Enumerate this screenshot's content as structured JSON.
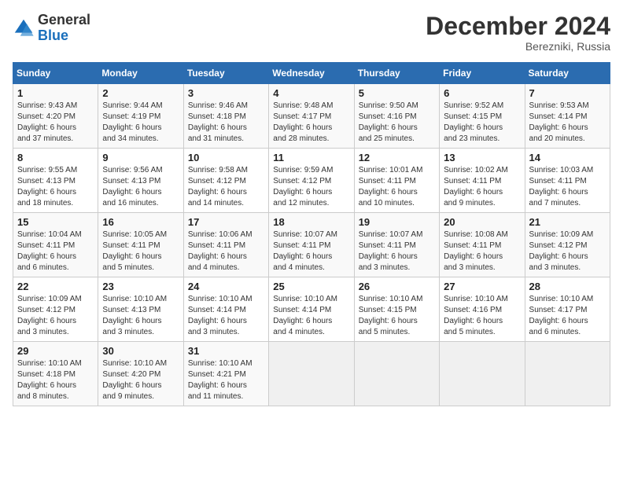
{
  "header": {
    "logo": {
      "general": "General",
      "blue": "Blue"
    },
    "title": "December 2024",
    "location": "Berezniki, Russia"
  },
  "weekdays": [
    "Sunday",
    "Monday",
    "Tuesday",
    "Wednesday",
    "Thursday",
    "Friday",
    "Saturday"
  ],
  "weeks": [
    [
      {
        "day": "1",
        "sunrise": "9:43 AM",
        "sunset": "4:20 PM",
        "daylight": "6 hours and 37 minutes."
      },
      {
        "day": "2",
        "sunrise": "9:44 AM",
        "sunset": "4:19 PM",
        "daylight": "6 hours and 34 minutes."
      },
      {
        "day": "3",
        "sunrise": "9:46 AM",
        "sunset": "4:18 PM",
        "daylight": "6 hours and 31 minutes."
      },
      {
        "day": "4",
        "sunrise": "9:48 AM",
        "sunset": "4:17 PM",
        "daylight": "6 hours and 28 minutes."
      },
      {
        "day": "5",
        "sunrise": "9:50 AM",
        "sunset": "4:16 PM",
        "daylight": "6 hours and 25 minutes."
      },
      {
        "day": "6",
        "sunrise": "9:52 AM",
        "sunset": "4:15 PM",
        "daylight": "6 hours and 23 minutes."
      },
      {
        "day": "7",
        "sunrise": "9:53 AM",
        "sunset": "4:14 PM",
        "daylight": "6 hours and 20 minutes."
      }
    ],
    [
      {
        "day": "8",
        "sunrise": "9:55 AM",
        "sunset": "4:13 PM",
        "daylight": "6 hours and 18 minutes."
      },
      {
        "day": "9",
        "sunrise": "9:56 AM",
        "sunset": "4:13 PM",
        "daylight": "6 hours and 16 minutes."
      },
      {
        "day": "10",
        "sunrise": "9:58 AM",
        "sunset": "4:12 PM",
        "daylight": "6 hours and 14 minutes."
      },
      {
        "day": "11",
        "sunrise": "9:59 AM",
        "sunset": "4:12 PM",
        "daylight": "6 hours and 12 minutes."
      },
      {
        "day": "12",
        "sunrise": "10:01 AM",
        "sunset": "4:11 PM",
        "daylight": "6 hours and 10 minutes."
      },
      {
        "day": "13",
        "sunrise": "10:02 AM",
        "sunset": "4:11 PM",
        "daylight": "6 hours and 9 minutes."
      },
      {
        "day": "14",
        "sunrise": "10:03 AM",
        "sunset": "4:11 PM",
        "daylight": "6 hours and 7 minutes."
      }
    ],
    [
      {
        "day": "15",
        "sunrise": "10:04 AM",
        "sunset": "4:11 PM",
        "daylight": "6 hours and 6 minutes."
      },
      {
        "day": "16",
        "sunrise": "10:05 AM",
        "sunset": "4:11 PM",
        "daylight": "6 hours and 5 minutes."
      },
      {
        "day": "17",
        "sunrise": "10:06 AM",
        "sunset": "4:11 PM",
        "daylight": "6 hours and 4 minutes."
      },
      {
        "day": "18",
        "sunrise": "10:07 AM",
        "sunset": "4:11 PM",
        "daylight": "6 hours and 4 minutes."
      },
      {
        "day": "19",
        "sunrise": "10:07 AM",
        "sunset": "4:11 PM",
        "daylight": "6 hours and 3 minutes."
      },
      {
        "day": "20",
        "sunrise": "10:08 AM",
        "sunset": "4:11 PM",
        "daylight": "6 hours and 3 minutes."
      },
      {
        "day": "21",
        "sunrise": "10:09 AM",
        "sunset": "4:12 PM",
        "daylight": "6 hours and 3 minutes."
      }
    ],
    [
      {
        "day": "22",
        "sunrise": "10:09 AM",
        "sunset": "4:12 PM",
        "daylight": "6 hours and 3 minutes."
      },
      {
        "day": "23",
        "sunrise": "10:10 AM",
        "sunset": "4:13 PM",
        "daylight": "6 hours and 3 minutes."
      },
      {
        "day": "24",
        "sunrise": "10:10 AM",
        "sunset": "4:14 PM",
        "daylight": "6 hours and 3 minutes."
      },
      {
        "day": "25",
        "sunrise": "10:10 AM",
        "sunset": "4:14 PM",
        "daylight": "6 hours and 4 minutes."
      },
      {
        "day": "26",
        "sunrise": "10:10 AM",
        "sunset": "4:15 PM",
        "daylight": "6 hours and 5 minutes."
      },
      {
        "day": "27",
        "sunrise": "10:10 AM",
        "sunset": "4:16 PM",
        "daylight": "6 hours and 5 minutes."
      },
      {
        "day": "28",
        "sunrise": "10:10 AM",
        "sunset": "4:17 PM",
        "daylight": "6 hours and 6 minutes."
      }
    ],
    [
      {
        "day": "29",
        "sunrise": "10:10 AM",
        "sunset": "4:18 PM",
        "daylight": "6 hours and 8 minutes."
      },
      {
        "day": "30",
        "sunrise": "10:10 AM",
        "sunset": "4:20 PM",
        "daylight": "6 hours and 9 minutes."
      },
      {
        "day": "31",
        "sunrise": "10:10 AM",
        "sunset": "4:21 PM",
        "daylight": "6 hours and 11 minutes."
      },
      null,
      null,
      null,
      null
    ]
  ]
}
